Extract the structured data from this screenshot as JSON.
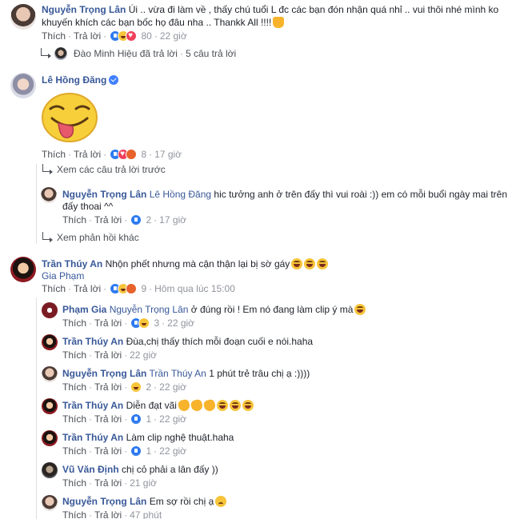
{
  "comments": [
    {
      "author": "Nguyễn Trọng Lân",
      "text_line1": "Úi .. vừa đi làm về , thấy chú tuổi L đc các bạn đón nhận quá nhỉ .. vui thôi nhé mình ko",
      "text_line2": "khuyến khích các bạn bốc họ đâu nha .. Thankk All !!!!",
      "like": "Thích",
      "reply": "Trả lời",
      "reaction_count": "80",
      "time": "22 giờ",
      "replies_summary": {
        "name": "Đào Minh Hiệu",
        "action": "đã trả lời",
        "count_text": "5 câu trả lời"
      }
    },
    {
      "author": "Lê Hồng Đăng",
      "like": "Thích",
      "reply": "Trả lời",
      "reaction_count": "8",
      "time": "17 giờ",
      "view_previous": "Xem các câu trả lời trước",
      "view_more": "Xem phản hồi khác",
      "reply1": {
        "author": "Nguyễn Trọng Lân",
        "mention": "Lê Hồng Đăng",
        "text_line1": "hic tưởng anh ở trên đấy thì vui roài :)) em có mỗi buổi ngày mai trên",
        "text_line2": "đấy thoai ^^",
        "like": "Thích",
        "reply": "Trả lời",
        "reaction_count": "2",
        "time": "17 giờ"
      }
    },
    {
      "author": "Trần Thúy An",
      "text": "Nhộn phết nhưng mà cận thận lại bị sờ gáy",
      "tag": "Gia Phạm",
      "like": "Thích",
      "reply": "Trả lời",
      "reaction_count": "9",
      "time": "Hôm qua lúc 15:00",
      "replies": [
        {
          "author": "Phạm Gia",
          "mention": "Nguyễn Trọng Lân",
          "text": "ở đúng rồi ! Em nó đang làm clip ý mà",
          "like": "Thích",
          "reply": "Trả lời",
          "reaction_count": "3",
          "time": "22 giờ"
        },
        {
          "author": "Trần Thúy An",
          "text": "Đùa,chị thấy thích mỗi đoạn cuối e nói.haha",
          "like": "Thích",
          "reply": "Trả lời",
          "time": "22 giờ"
        },
        {
          "author": "Nguyễn Trọng Lân",
          "mention": "Trần Thúy An",
          "text": "1 phút trẻ trâu chị ạ :))))",
          "like": "Thích",
          "reply": "Trả lời",
          "reaction_count": "2",
          "time": "22 giờ"
        },
        {
          "author": "Trần Thúy An",
          "text": "Diễn đạt vãi",
          "like": "Thích",
          "reply": "Trả lời",
          "reaction_count": "1",
          "time": "22 giờ"
        },
        {
          "author": "Trần Thúy An",
          "text": "Làm clip nghệ thuật.haha",
          "like": "Thích",
          "reply": "Trả lời",
          "reaction_count": "1",
          "time": "22 giờ"
        },
        {
          "author": "Vũ Văn Định",
          "text": "chị cỏ phải a lân đấy ))",
          "like": "Thích",
          "reply": "Trả lời",
          "time": "21 giờ"
        },
        {
          "author": "Nguyễn Trọng Lân",
          "text": "Em sợ rồi chị ạ",
          "like": "Thích",
          "reply": "Trả lời",
          "time": "47 phút"
        }
      ]
    }
  ],
  "colors": {
    "name": "#385898",
    "meta": "#90949c",
    "link": "#4b4f56"
  }
}
